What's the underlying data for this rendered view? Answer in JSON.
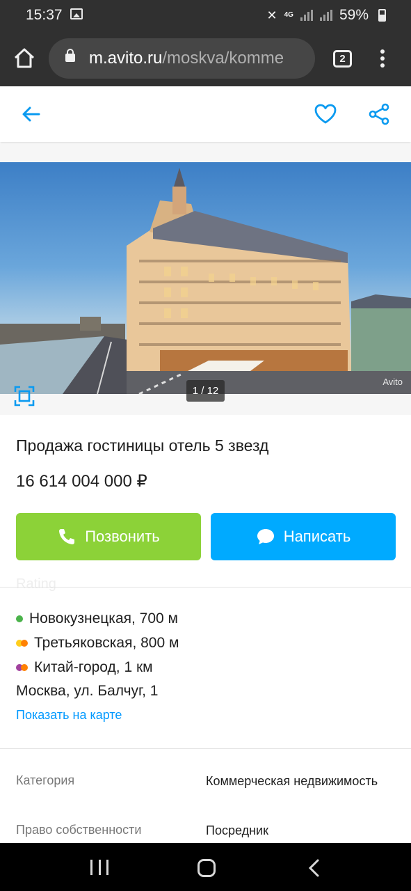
{
  "status_bar": {
    "time": "15:37",
    "network": "4G",
    "battery": "59%",
    "icons": [
      "image-icon",
      "mute-icon",
      "signal-icon",
      "battery-icon"
    ]
  },
  "browser": {
    "url_host": "m.avito.ru",
    "url_path": "/moskva/komme",
    "tab_count": "2",
    "icons": [
      "home-icon",
      "lock-icon",
      "tabs-icon",
      "menu-icon"
    ]
  },
  "header": {
    "icons": [
      "back-arrow-icon",
      "heart-icon",
      "share-icon"
    ],
    "accent": "#0a9af0"
  },
  "gallery": {
    "counter": "1 / 12",
    "watermark": "Avito",
    "icons": [
      "expand-icon"
    ]
  },
  "listing": {
    "title": "Продажа гостиницы отель 5 звезд",
    "price": "16 614 004 000 ₽"
  },
  "actions": {
    "call_label": "Позвонить",
    "write_label": "Написать",
    "call_color": "#8cd238",
    "write_color": "#00aaff"
  },
  "faded_label": "Rating",
  "location": {
    "metro": [
      {
        "name": "Новокузнецкая, 700 м",
        "colors": [
          "#4bb34b"
        ]
      },
      {
        "name": "Третьяковская, 800 м",
        "colors": [
          "#ffcd1c",
          "#ff8103"
        ]
      },
      {
        "name": "Китай-город, 1 км",
        "colors": [
          "#a1419e",
          "#ff8103"
        ]
      }
    ],
    "address": "Москва, ул. Балчуг, 1",
    "map_link": "Показать на карте"
  },
  "params": [
    {
      "label": "Категория",
      "value": "Коммерческая недвижимость"
    },
    {
      "label": "Право собственности",
      "value": "Посредник"
    }
  ]
}
